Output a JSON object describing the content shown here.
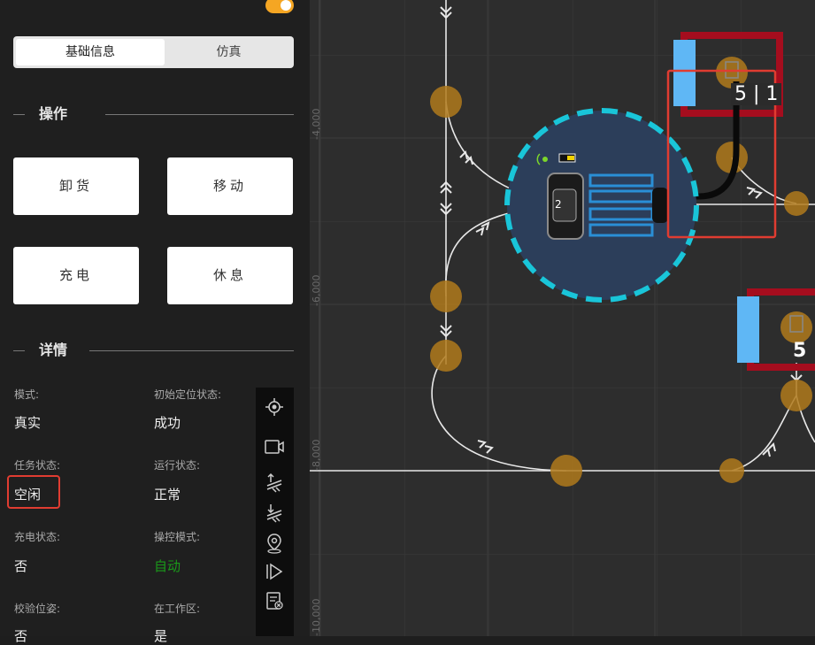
{
  "tabs": {
    "active": "基础信息",
    "inactive": "仿真"
  },
  "operation": {
    "title": "操作",
    "buttons": {
      "unload": "卸货",
      "move": "移动",
      "charge": "充电",
      "rest": "休息"
    }
  },
  "details": {
    "title": "详情",
    "fields": [
      {
        "label": "模式:",
        "value": "真实"
      },
      {
        "label": "初始定位状态:",
        "value": "成功"
      },
      {
        "label": "任务状态:",
        "value": "空闲"
      },
      {
        "label": "运行状态:",
        "value": "正常"
      },
      {
        "label": "充电状态:",
        "value": "否"
      },
      {
        "label": "操控模式:",
        "value": "自动"
      },
      {
        "label": "校验位姿:",
        "value": "否"
      },
      {
        "label": "在工作区:",
        "value": "是"
      }
    ]
  },
  "toolbar": {
    "icons": [
      "locate-icon",
      "camera-icon",
      "load-up-icon",
      "load-down-icon",
      "map-pin-icon",
      "play-icon",
      "cancel-task-icon"
    ]
  },
  "map": {
    "axis": {
      "y1": "-4,000",
      "y2": "-6,000",
      "y3": "-8,000",
      "y4": "-10,000"
    },
    "robot": {
      "id": "2"
    },
    "station1": {
      "label": "5 | 1"
    },
    "station2": {
      "label": "5"
    }
  },
  "colors": {
    "accent": "#f5a623",
    "highlight": "#e03c31",
    "auto_green": "#1a9a1a",
    "robot_ring": "#19c5d9",
    "node": "#b07a1c",
    "station_red": "#a50d1e",
    "station_blue": "#5fb7f5"
  }
}
